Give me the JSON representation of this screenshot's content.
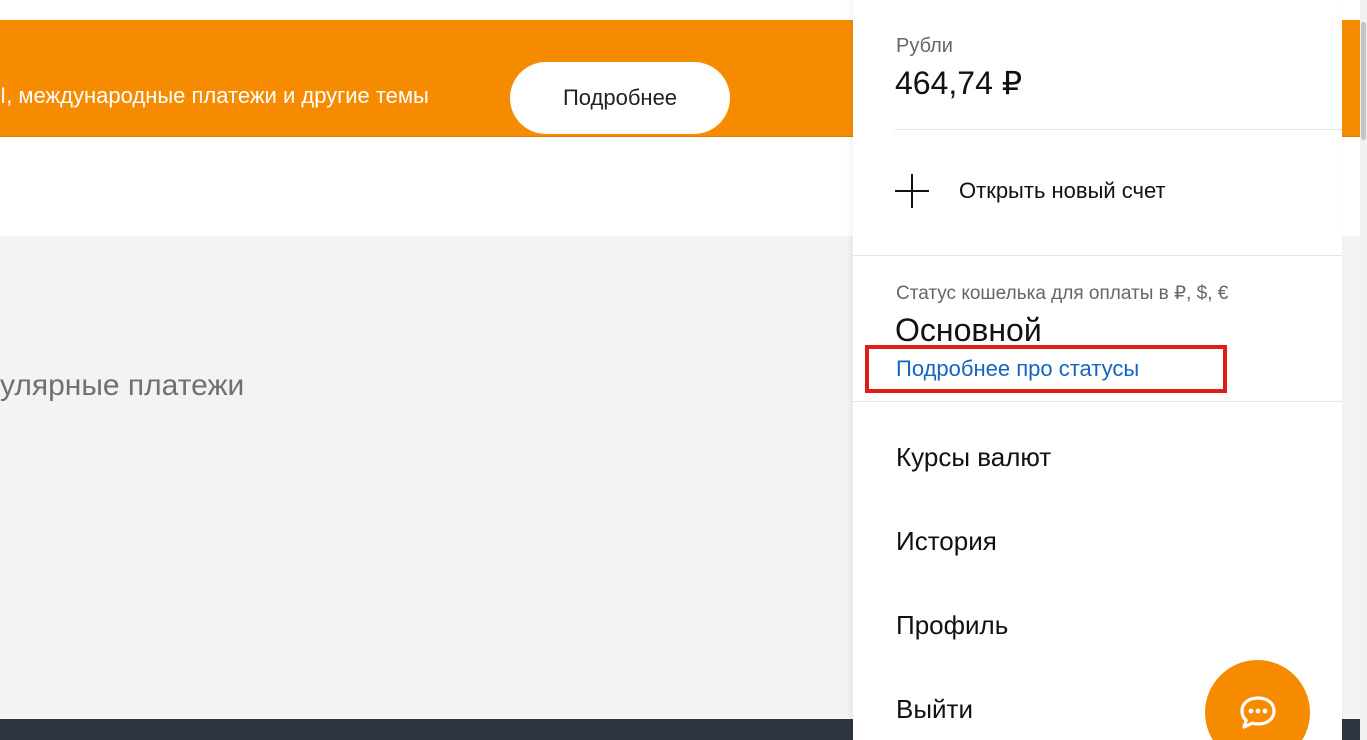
{
  "banner": {
    "text": "I, международные платежи и другие темы",
    "button_label": "Подробнее"
  },
  "main": {
    "section_heading": "улярные платежи"
  },
  "panel": {
    "rub_label": "Рубли",
    "rub_balance": "464,74 ₽",
    "open_account_label": "Открыть новый счет",
    "status_caption": "Статус кошелька для оплаты в ₽, $, €",
    "status_value": "Основной",
    "status_link": "Подробнее про статусы",
    "menu": [
      {
        "label": "Курсы валют"
      },
      {
        "label": "История"
      },
      {
        "label": "Профиль"
      },
      {
        "label": "Выйти"
      }
    ]
  },
  "icons": {
    "plus": "plus-icon",
    "chat": "chat-bubble-icon"
  },
  "colors": {
    "accent": "#f78b00",
    "link": "#1565c0",
    "highlight": "#e21b1b",
    "footer": "#2f3540"
  }
}
